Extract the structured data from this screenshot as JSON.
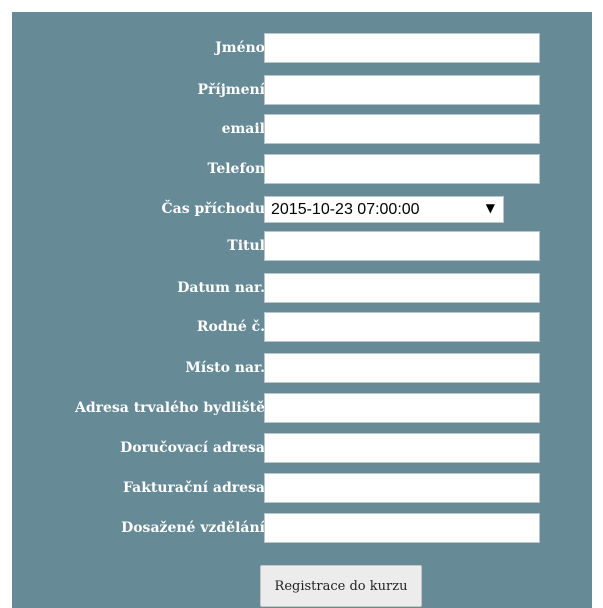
{
  "form": {
    "fields": [
      {
        "label": "Jméno",
        "value": ""
      },
      {
        "label": "Příjmení",
        "value": ""
      },
      {
        "label": "email",
        "value": ""
      },
      {
        "label": "Telefon",
        "value": ""
      },
      {
        "label": "Čas příchodu",
        "value": "2015-10-23 07:00:00"
      },
      {
        "label": "Titul",
        "value": ""
      },
      {
        "label": "Datum nar.",
        "value": ""
      },
      {
        "label": "Rodné č.",
        "value": ""
      },
      {
        "label": "Místo nar.",
        "value": ""
      },
      {
        "label": "Adresa trvalého bydliště",
        "value": ""
      },
      {
        "label": "Doručovací adresa",
        "value": ""
      },
      {
        "label": "Fakturační adresa",
        "value": ""
      },
      {
        "label": "Dosažené vzdělání",
        "value": ""
      }
    ],
    "submit_label": "Registrace do kurzu"
  },
  "colors": {
    "panel_bg": "#668a96",
    "label_text": "#ffffff"
  },
  "icons": {
    "select_arrow": "dropdown-arrow-icon"
  }
}
